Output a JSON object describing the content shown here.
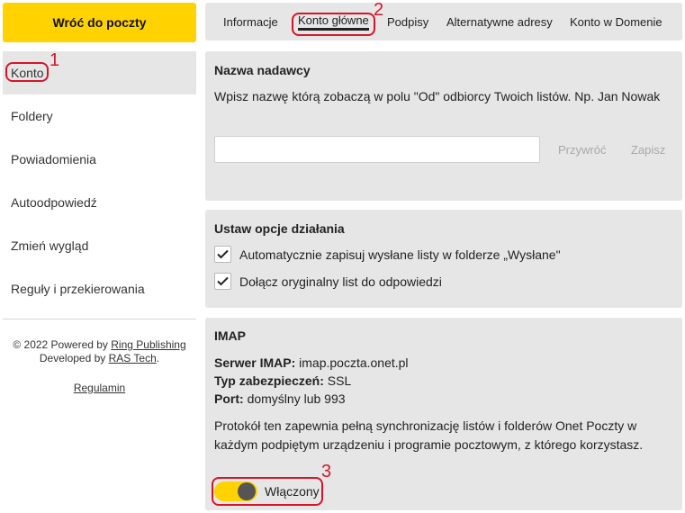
{
  "sidebar": {
    "back_label": "Wróć do poczty",
    "items": [
      {
        "label": "Konto"
      },
      {
        "label": "Foldery"
      },
      {
        "label": "Powiadomienia"
      },
      {
        "label": "Autoodpowiedź"
      },
      {
        "label": "Zmień wygląd"
      },
      {
        "label": "Reguły i przekierowania"
      }
    ],
    "footer": {
      "copyright_prefix": "© 2022 Powered by ",
      "powered_link": "Ring Publishing",
      "developed_prefix": "Developed by ",
      "developed_link": "RAS Tech",
      "developed_suffix": ".",
      "regulamin": "Regulamin"
    }
  },
  "tabs": [
    {
      "label": "Informacje"
    },
    {
      "label": "Konto główne"
    },
    {
      "label": "Podpisy"
    },
    {
      "label": "Alternatywne adresy"
    },
    {
      "label": "Konto w Domenie"
    }
  ],
  "sender": {
    "title": "Nazwa nadawcy",
    "description": "Wpisz nazwę którą zobaczą w polu \"Od\" odbiorcy Twoich listów. Np. Jan Nowak",
    "input_value": "",
    "restore_label": "Przywróć",
    "save_label": "Zapisz"
  },
  "options": {
    "title": "Ustaw opcje działania",
    "items": [
      {
        "label": "Automatycznie zapisuj wysłane listy w folderze „Wysłane\"",
        "checked": true
      },
      {
        "label": "Dołącz oryginalny list do odpowiedzi",
        "checked": true
      }
    ]
  },
  "imap": {
    "title": "IMAP",
    "server_label": "Serwer IMAP:",
    "server_value": "imap.poczta.onet.pl",
    "security_label": "Typ zabezpieczeń:",
    "security_value": "SSL",
    "port_label": "Port:",
    "port_value": "domyślny lub 993",
    "description": "Protokół ten zapewnia pełną synchronizację listów i folderów Onet Poczty w każdym podpiętym urządzeniu i programie pocztowym, z którego korzystasz.",
    "toggle_label": "Włączony",
    "toggle_on": true
  },
  "annotations": [
    "1",
    "2",
    "3"
  ],
  "colors": {
    "accent": "#ffd200",
    "panel": "#e6e6e6",
    "annotation": "#d6152a"
  }
}
